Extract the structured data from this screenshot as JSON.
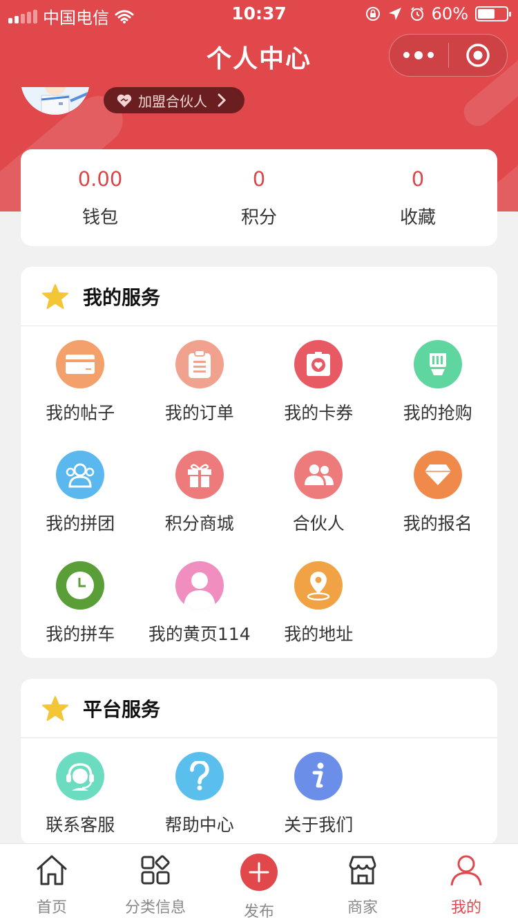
{
  "status_bar": {
    "carrier": "中国电信",
    "time": "10:37",
    "battery": "60%"
  },
  "nav": {
    "title": "个人中心"
  },
  "profile": {
    "partner_label": "加盟合伙人"
  },
  "stats": [
    {
      "value": "0.00",
      "label": "钱包"
    },
    {
      "value": "0",
      "label": "积分"
    },
    {
      "value": "0",
      "label": "收藏"
    }
  ],
  "my_services": {
    "title": "我的服务",
    "items": [
      {
        "label": "我的帖子",
        "icon": "card-icon",
        "color": "#f3a06b"
      },
      {
        "label": "我的订单",
        "icon": "clipboard-icon",
        "color": "#f1a28e"
      },
      {
        "label": "我的卡券",
        "icon": "coupon-icon",
        "color": "#e85a63"
      },
      {
        "label": "我的抢购",
        "icon": "flash-sale-icon",
        "color": "#5fd6a0"
      },
      {
        "label": "我的拼团",
        "icon": "group-icon",
        "color": "#5ab8ee"
      },
      {
        "label": "积分商城",
        "icon": "gift-icon",
        "color": "#ee7b7b"
      },
      {
        "label": "合伙人",
        "icon": "partners-icon",
        "color": "#ee7b7b"
      },
      {
        "label": "我的报名",
        "icon": "diamond-icon",
        "color": "#f08a4b"
      },
      {
        "label": "我的拼车",
        "icon": "clock-icon",
        "color": "#5a9e38"
      },
      {
        "label": "我的黄页114",
        "icon": "person-icon",
        "color": "#f08ec0"
      },
      {
        "label": "我的地址",
        "icon": "location-icon",
        "color": "#f0a245"
      }
    ]
  },
  "platform_services": {
    "title": "平台服务",
    "items": [
      {
        "label": "联系客服",
        "icon": "customer-service-icon",
        "color": "#6cdcc0"
      },
      {
        "label": "帮助中心",
        "icon": "question-icon",
        "color": "#5bbfee"
      },
      {
        "label": "关于我们",
        "icon": "info-icon",
        "color": "#6b8ee8"
      }
    ]
  },
  "tabbar": [
    {
      "label": "首页",
      "icon": "home-icon",
      "active": false
    },
    {
      "label": "分类信息",
      "icon": "category-icon",
      "active": false
    },
    {
      "label": "发布",
      "icon": "plus-icon",
      "active": false
    },
    {
      "label": "商家",
      "icon": "shop-icon",
      "active": false
    },
    {
      "label": "我的",
      "icon": "user-icon",
      "active": true
    }
  ],
  "colors": {
    "brand": "#e0484c",
    "star": "#f3c636"
  }
}
